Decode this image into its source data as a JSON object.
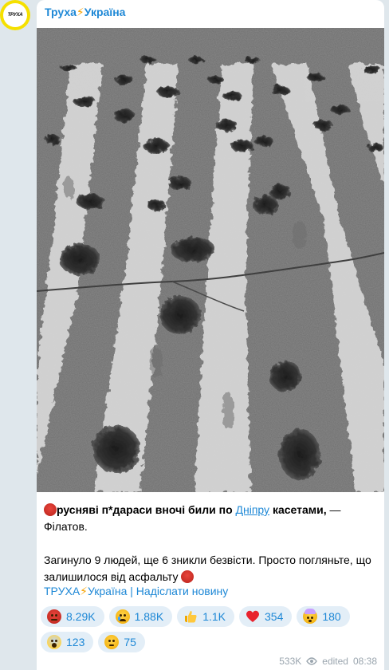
{
  "channel": {
    "name": "Труха",
    "bolt": "⚡",
    "country": "Україна",
    "avatar_text": "ТРУХА",
    "avatar_color": "#f5e000"
  },
  "photo": {
    "icon": "photo-crosswalk-potholes"
  },
  "caption": {
    "part1": "русняві п*дараси вночі били по ",
    "link": "Дніпру",
    "part2": " касетами,",
    "part3": " — Філатов.",
    "paragraph2": "Загинуло 9 людей, ще 6 зникли безвісти. Просто погляньте, що залишилося від асфальту"
  },
  "footer": {
    "channel": "ТРУХА",
    "bolt": "⚡",
    "country": "Україна",
    "separator": " | ",
    "submit": "Надіслати новину"
  },
  "reactions": [
    {
      "icon": "angry-face-icon",
      "count": "8.29K"
    },
    {
      "icon": "crying-face-icon",
      "count": "1.88K"
    },
    {
      "icon": "thumbs-up-icon",
      "count": "1.1K"
    },
    {
      "icon": "heart-icon",
      "count": "354"
    },
    {
      "icon": "exploding-head-icon",
      "count": "180"
    },
    {
      "icon": "screaming-face-icon",
      "count": "123"
    },
    {
      "icon": "neutral-face-icon",
      "count": "75"
    }
  ],
  "meta": {
    "views": "533K",
    "edited": "edited",
    "time": "08:38"
  },
  "colors": {
    "link": "#1e88d6",
    "reaction_bg": "#e3eef7",
    "bolt": "#f6a200",
    "page_bg": "#dfe7ec"
  }
}
